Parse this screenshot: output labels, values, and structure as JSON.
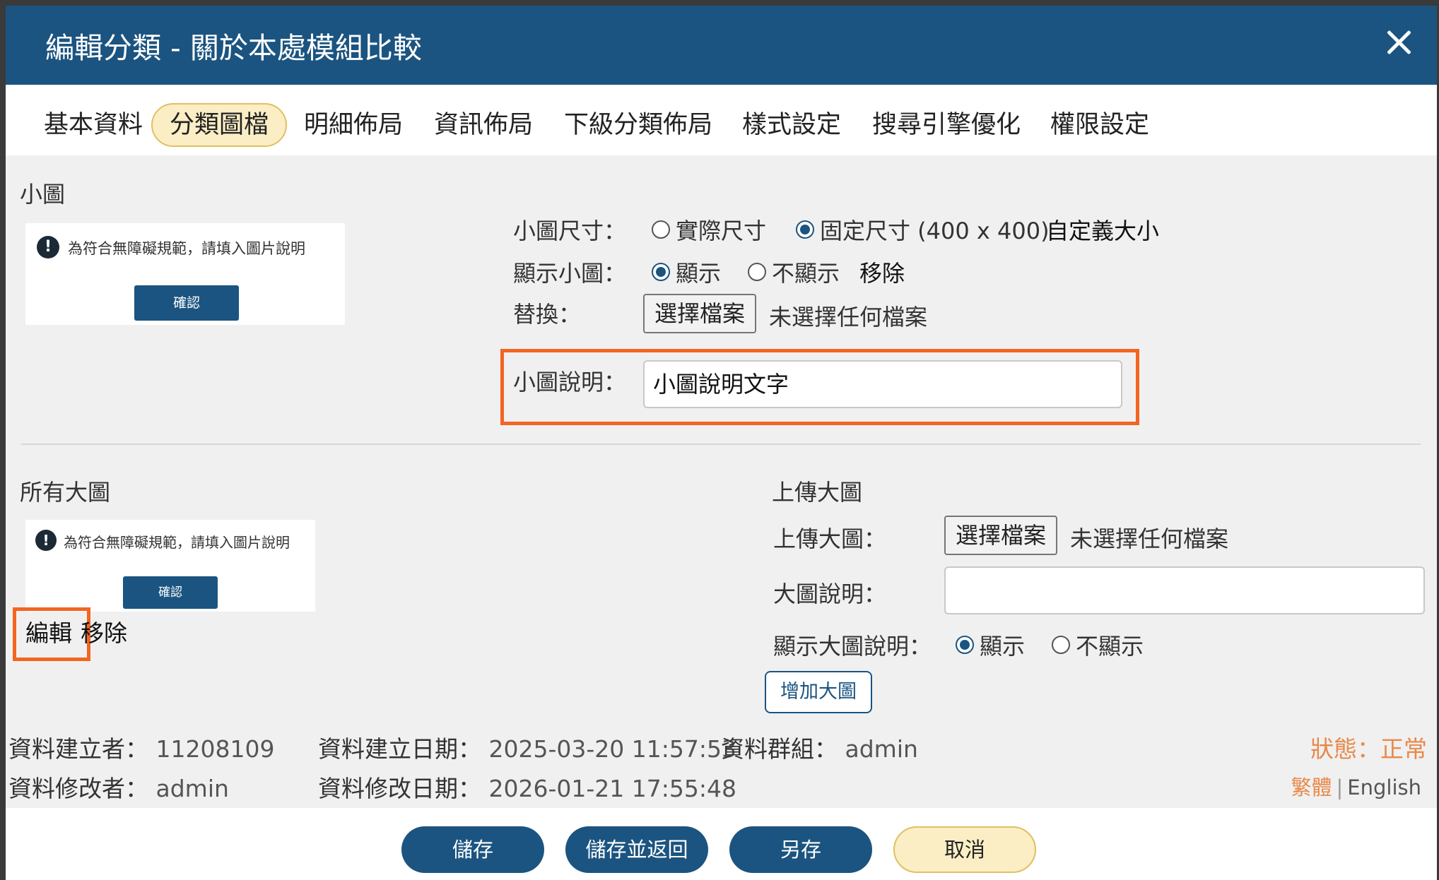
{
  "dialog": {
    "title": "編輯分類 - 關於本處模組比較"
  },
  "tabs": [
    {
      "label": "基本資料"
    },
    {
      "label": "分類圖檔",
      "active": true
    },
    {
      "label": "明細佈局"
    },
    {
      "label": "資訊佈局"
    },
    {
      "label": "下級分類佈局"
    },
    {
      "label": "樣式設定"
    },
    {
      "label": "搜尋引擎優化"
    },
    {
      "label": "權限設定"
    }
  ],
  "small_image": {
    "section_title": "小圖",
    "preview": {
      "alert_text": "為符合無障礙規範，請填入圖片說明",
      "confirm_label": "確認"
    },
    "size": {
      "label": "小圖尺寸：",
      "option_actual": "實際尺寸",
      "option_fixed": "固定尺寸 (400 x 400)",
      "custom_link": "自定義大小",
      "selected": "fixed"
    },
    "show": {
      "label": "顯示小圖：",
      "option_show": "顯示",
      "option_hide": "不顯示",
      "remove_link": "移除",
      "selected": "show"
    },
    "replace": {
      "label": "替換：",
      "file_button": "選擇檔案",
      "file_status": "未選擇任何檔案"
    },
    "caption": {
      "label": "小圖說明：",
      "value": "小圖說明文字"
    }
  },
  "large_images": {
    "section_title": "所有大圖",
    "preview": {
      "alert_text": "為符合無障礙規範，請填入圖片說明",
      "confirm_label": "確認"
    },
    "edit_link": "編輯",
    "remove_link": "移除"
  },
  "upload_large": {
    "section_title": "上傳大圖",
    "upload": {
      "label": "上傳大圖：",
      "file_button": "選擇檔案",
      "file_status": "未選擇任何檔案"
    },
    "caption": {
      "label": "大圖說明：",
      "value": ""
    },
    "show_caption": {
      "label": "顯示大圖說明：",
      "option_show": "顯示",
      "option_hide": "不顯示",
      "selected": "show"
    },
    "add_button": "增加大圖"
  },
  "meta": {
    "creator_label": "資料建立者：",
    "creator": "11208109",
    "created_date_label": "資料建立日期：",
    "created_date": "2025-03-20 11:57:53",
    "group_label": "資料群組：",
    "group": "admin",
    "modifier_label": "資料修改者：",
    "modifier": "admin",
    "modified_date_label": "資料修改日期：",
    "modified_date": "2026-01-21 17:55:48",
    "status": "狀態：正常",
    "lang_zh": "繁體",
    "lang_sep": "|",
    "lang_en": "English"
  },
  "footer": {
    "save": "儲存",
    "save_return": "儲存並返回",
    "save_as": "另存",
    "cancel": "取消"
  },
  "colors": {
    "header": "#1b5480",
    "accent_orange": "#f26522",
    "tab_active_bg": "#fbeec5",
    "status_orange": "#e8894a"
  }
}
